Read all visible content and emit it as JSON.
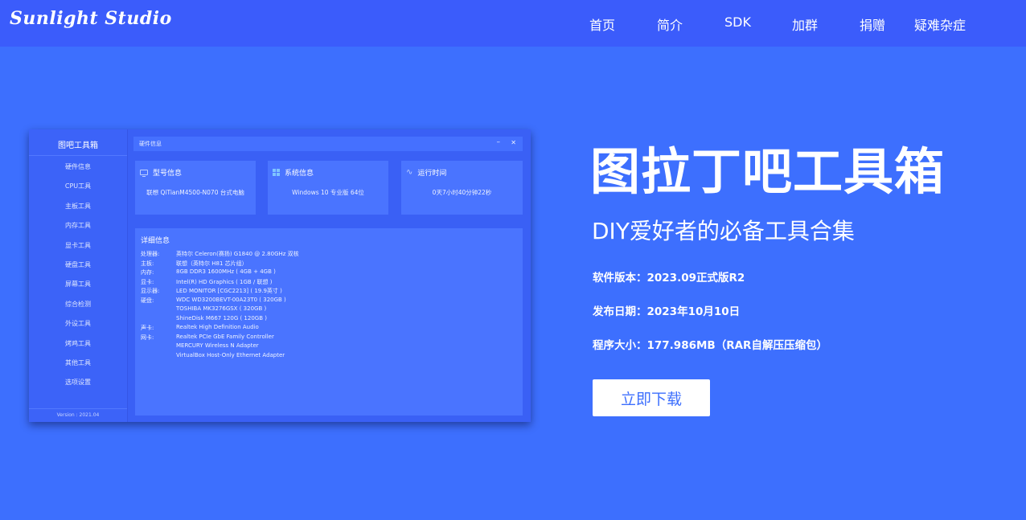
{
  "header": {
    "logo": "Sunlight Studio",
    "nav": [
      "首页",
      "简介",
      "SDK",
      "加群",
      "捐赠",
      "疑难杂症"
    ]
  },
  "app_preview": {
    "brand": "图吧工具箱",
    "window_title": "硬件信息",
    "menu": [
      "硬件信息",
      "CPU工具",
      "主板工具",
      "内存工具",
      "显卡工具",
      "硬盘工具",
      "屏幕工具",
      "综合检测",
      "外设工具",
      "烤鸡工具",
      "其他工具",
      "选项设置"
    ],
    "version": "Version : 2021.04",
    "cards": [
      {
        "title": "型号信息",
        "icon": "monitor-icon",
        "value": "联想 QiTianM4500-N070 台式电脑"
      },
      {
        "title": "系统信息",
        "icon": "windows-icon",
        "value": "Windows 10 专业版 64位"
      },
      {
        "title": "运行时间",
        "icon": "pulse-icon",
        "value": "0天7小时40分钟22秒"
      }
    ],
    "detail_title": "详细信息",
    "details": [
      {
        "k": "处理器:",
        "v": "英特尔 Celeron(赛扬) G1840 @ 2.80GHz 双核"
      },
      {
        "k": "主板:",
        "v": "联想（英特尔 H81 芯片组）"
      },
      {
        "k": "内存:",
        "v": "8GB DDR3 1600MHz ( 4GB + 4GB )"
      },
      {
        "k": "显卡:",
        "v": "Intel(R) HD Graphics ( 1GB / 联想 )"
      },
      {
        "k": "显示器:",
        "v": "LED MONITOR [CGC2213] ( 19.9英寸 )"
      },
      {
        "k": "硬盘:",
        "v": "WDC WD3200BEVT-00A23T0 ( 320GB )"
      },
      {
        "k": "",
        "v": "TOSHIBA MK3276GSX ( 320GB )"
      },
      {
        "k": "",
        "v": "ShineDisk M667 120G ( 120GB )"
      },
      {
        "k": "声卡:",
        "v": "Realtek High Definition Audio"
      },
      {
        "k": "网卡:",
        "v": "Realtek PCIe GbE Family Controller"
      },
      {
        "k": "",
        "v": "MERCURY Wireless N Adapter"
      },
      {
        "k": "",
        "v": "VirtualBox Host-Only Ethernet Adapter"
      }
    ]
  },
  "hero": {
    "title": "图拉丁吧工具箱",
    "subtitle": "DIY爱好者的必备工具合集",
    "version": "软件版本：2023.09正式版R2",
    "release_date": "发布日期：2023年10月10日",
    "size": "程序大小：177.986MB（RAR自解压压缩包）",
    "download_label": "立即下载"
  },
  "colors": {
    "background": "#3d6ffe",
    "header": "#3b5cfb",
    "button_text": "#3d6ffe"
  }
}
